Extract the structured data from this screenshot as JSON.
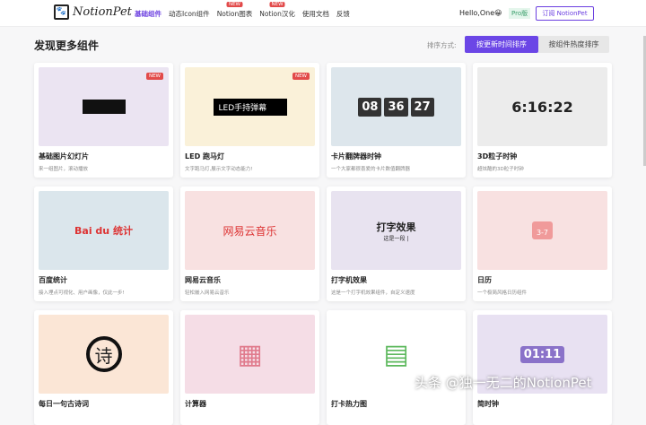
{
  "header": {
    "logo": "NotionPet",
    "nav": [
      {
        "label": "基础组件",
        "active": true
      },
      {
        "label": "动态Icon组件"
      },
      {
        "label": "Notion图表",
        "badge": "NEW"
      },
      {
        "label": "Notion汉化",
        "badge": "NEW"
      },
      {
        "label": "使用文档"
      },
      {
        "label": "反馈"
      }
    ],
    "greeting": "Hello,One😀",
    "pro": "Pro版",
    "subscribe": "订阅 NotionPet"
  },
  "page": {
    "title": "发现更多组件",
    "sort_label": "排序方式:",
    "sort_new": "按更新时间排序",
    "sort_hot": "按组件热度排序"
  },
  "cards": [
    {
      "title": "基础图片幻灯片",
      "desc": "来一组图片，滚动播放",
      "badge": "NEW",
      "bg": "#ebe4f2"
    },
    {
      "title": "LED 跑马灯",
      "desc": "文字跑马灯,展示文字动态能力!",
      "badge": "NEW",
      "bg": "#faf1d9",
      "preview": "LED手持弹幕"
    },
    {
      "title": "卡片翻牌器时钟",
      "desc": "一个大家都很喜爱的卡片数值翻牌器",
      "bg": "#dde6ec",
      "preview": [
        "08",
        "36",
        "27"
      ]
    },
    {
      "title": "3D粒子时钟",
      "desc": "超炫酷的3D粒子时钟",
      "bg": "#ececec",
      "preview": "6:16:22"
    },
    {
      "title": "百度统计",
      "desc": "接入埋点可视化、用户画像，仅此一步!",
      "bg": "#dbe6ec",
      "preview": "Bai du 统计"
    },
    {
      "title": "网易云音乐",
      "desc": "轻松嵌入网易云音乐",
      "bg": "#f8e1e1",
      "preview": "网易云音乐"
    },
    {
      "title": "打字机效果",
      "desc": "这是一个打字机效果组件，自定义速度",
      "bg": "#e8e3f0",
      "preview": "打字效果",
      "preview_sub": "这是一段 |"
    },
    {
      "title": "日历",
      "desc": "一个极简风格日历组件",
      "bg": "#f8e1e1",
      "preview": "3-7"
    },
    {
      "title": "每日一句古诗词",
      "desc": "",
      "bg": "#fbe6d6",
      "preview": "诗"
    },
    {
      "title": "计算器",
      "desc": "",
      "bg": "#f5dde6",
      "preview": "▦"
    },
    {
      "title": "打卡热力图",
      "desc": "",
      "bg": "#ffffff",
      "preview": "▤"
    },
    {
      "title": "简时钟",
      "desc": "",
      "bg": "#e8e1f2",
      "preview": "01:11"
    }
  ],
  "watermark": "头条 @独一无二的NotionPet"
}
